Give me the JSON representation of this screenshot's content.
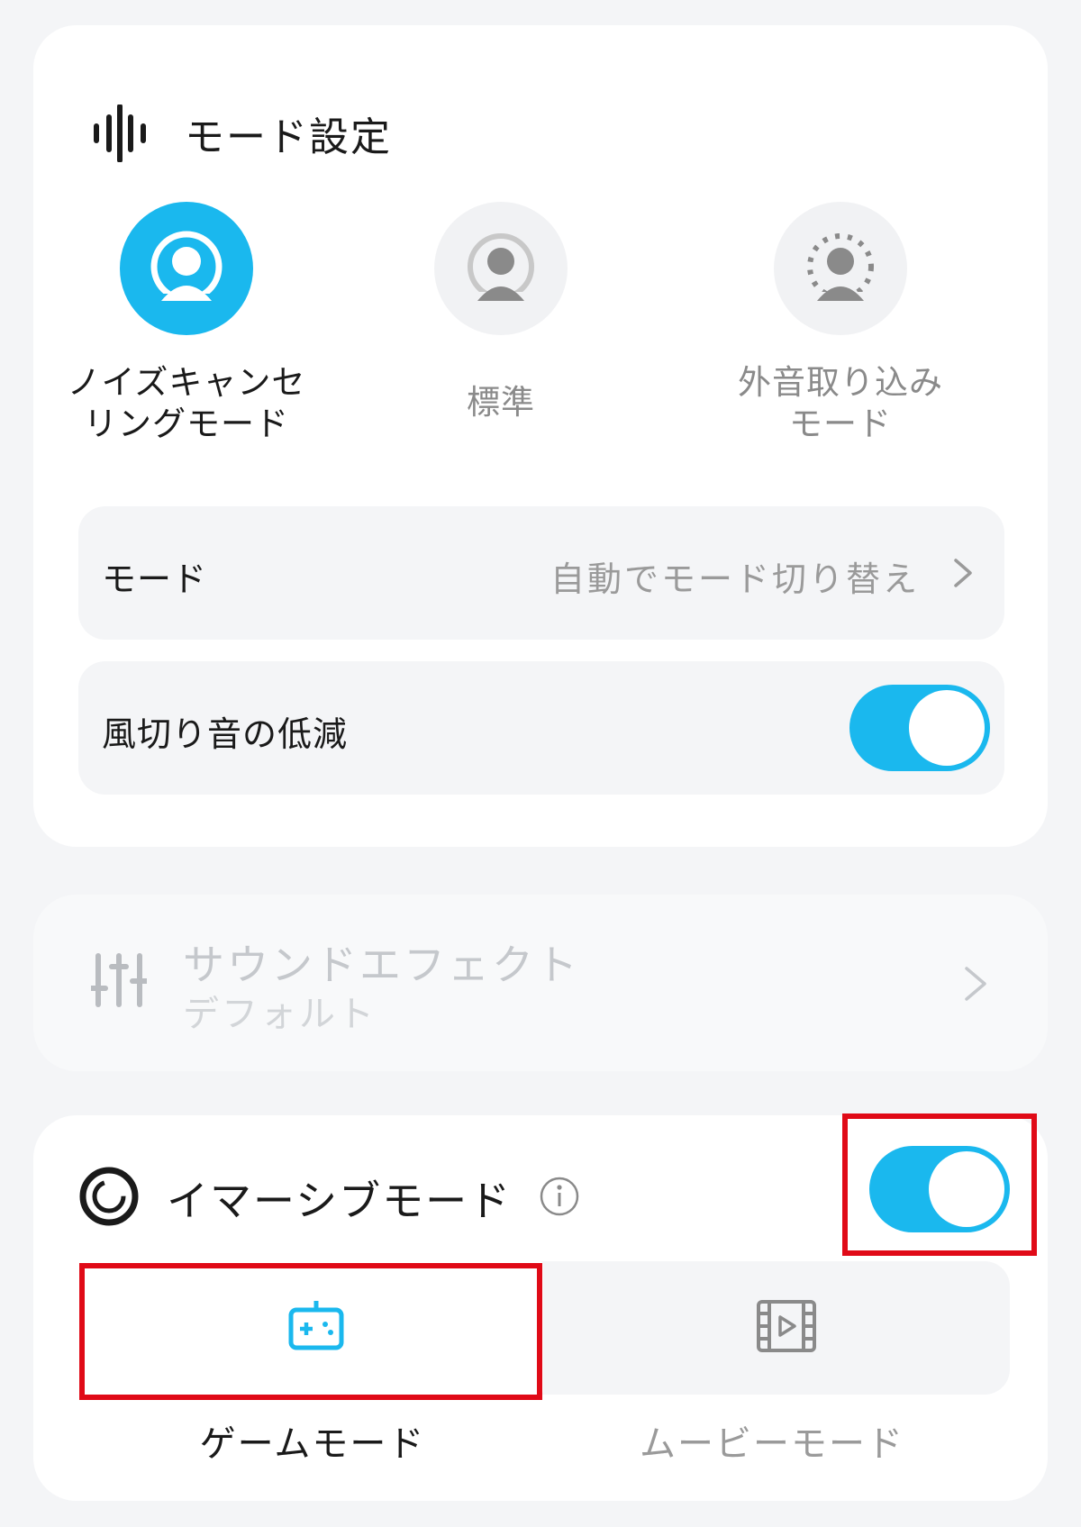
{
  "colors": {
    "accent": "#1ab8ee",
    "highlight_box": "#e00a17",
    "page_bg": "#f4f5f7"
  },
  "mode_card": {
    "title": "モード設定",
    "title_icon": "waveform-icon",
    "options": [
      {
        "label_line1": "ノイズキャンセ",
        "label_line2": "リングモード",
        "icon": "noise-cancel-icon",
        "selected": true
      },
      {
        "label_line1": "標準",
        "label_line2": "",
        "icon": "standard-mode-icon",
        "selected": false
      },
      {
        "label_line1": "外音取り込み",
        "label_line2": "モード",
        "icon": "ambient-sound-icon",
        "selected": false
      }
    ],
    "mode_row": {
      "label": "モード",
      "value": "自動でモード切り替え"
    },
    "wind_row": {
      "label": "風切り音の低減",
      "toggle_on": true
    }
  },
  "effect_card": {
    "title": "サウンドエフェクト",
    "subtitle": "デフォルト",
    "icon": "equalizer-icon"
  },
  "immersive_card": {
    "title": "イマーシブモード",
    "icon": "immersive-icon",
    "toggle_on": true,
    "tiles": [
      {
        "label": "ゲームモード",
        "icon": "gamepad-icon",
        "selected": true
      },
      {
        "label": "ムービーモード",
        "icon": "film-icon",
        "selected": false
      }
    ]
  }
}
